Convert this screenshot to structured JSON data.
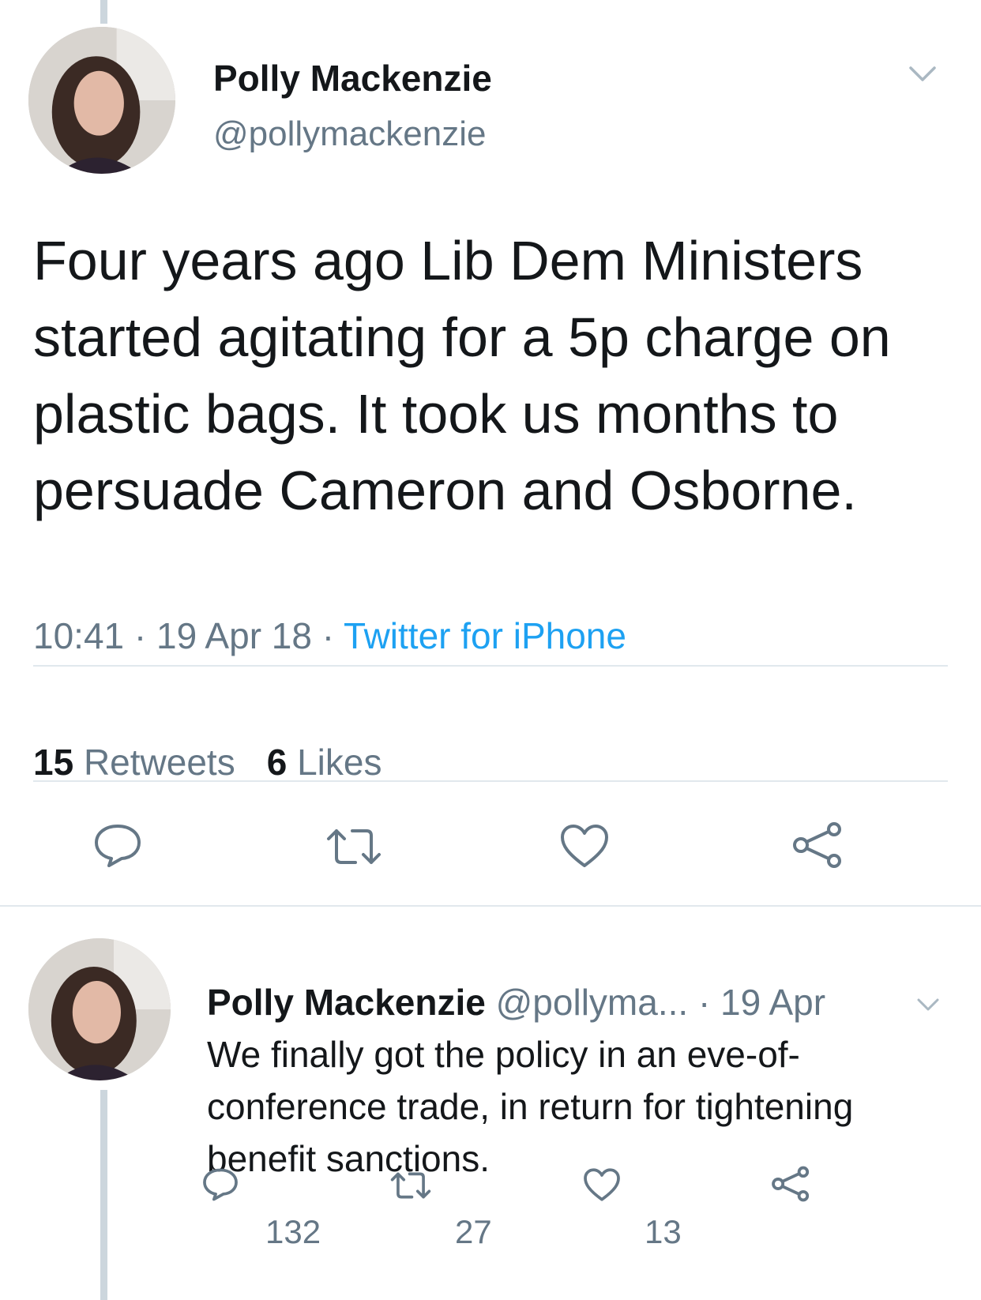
{
  "tweet": {
    "author_name": "Polly Mackenzie",
    "author_handle": "@pollymackenzie",
    "text": "Four years ago Lib Dem Ministers started agitating for a 5p charge on plastic bags. It took us months to persuade Cameron and Osborne.",
    "time": "10:41",
    "date": "19 Apr 18",
    "source": "Twitter for iPhone",
    "retweets_count": "15",
    "retweets_label": "Retweets",
    "likes_count": "6",
    "likes_label": "Likes"
  },
  "reply": {
    "author_name": "Polly Mackenzie",
    "author_handle": "@pollyma...",
    "date": "19 Apr",
    "text": "We finally got the policy in an eve-of-conference trade, in return for tightening benefit sanctions.",
    "reply_count": "132",
    "retweet_count": "27",
    "like_count": "13"
  },
  "icons": {
    "reply": "reply-icon",
    "retweet": "retweet-icon",
    "like": "heart-icon",
    "share": "share-icon",
    "more": "chevron-down-icon"
  },
  "colors": {
    "text": "#14171a",
    "secondary": "#657786",
    "link": "#1da1f2",
    "divider": "#e1e8ed"
  }
}
